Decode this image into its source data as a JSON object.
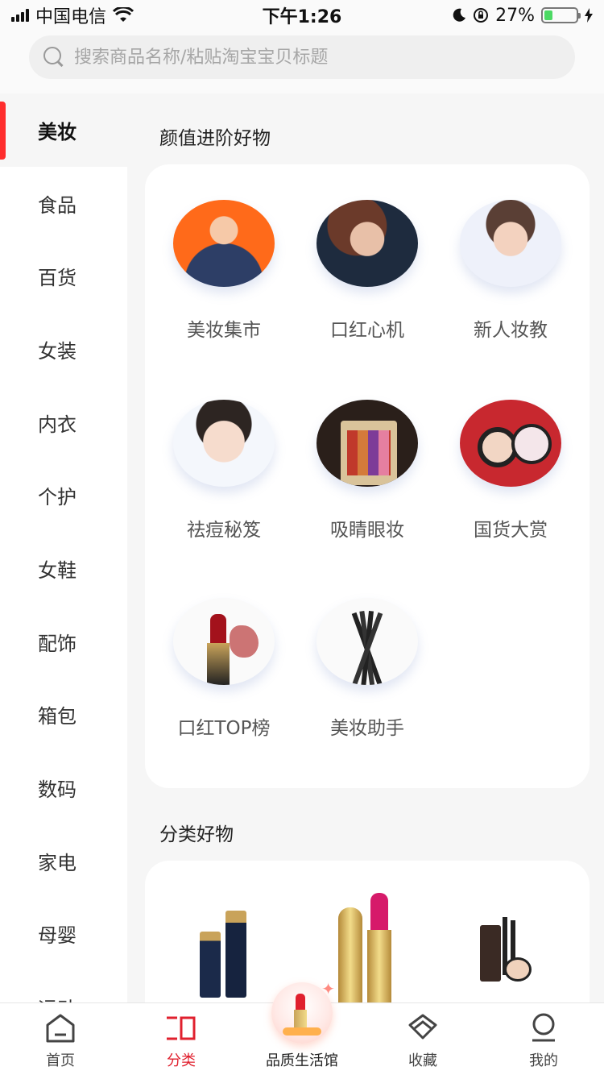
{
  "status_bar": {
    "carrier": "中国电信",
    "time": "下午1:26",
    "battery": "27%",
    "battery_level": 0.27
  },
  "search": {
    "placeholder": "搜索商品名称/粘贴淘宝宝贝标题"
  },
  "sidebar": {
    "items": [
      {
        "label": "美妆",
        "active": true
      },
      {
        "label": "食品"
      },
      {
        "label": "百货"
      },
      {
        "label": "女装"
      },
      {
        "label": "内衣"
      },
      {
        "label": "个护"
      },
      {
        "label": "女鞋"
      },
      {
        "label": "配饰"
      },
      {
        "label": "箱包"
      },
      {
        "label": "数码"
      },
      {
        "label": "家电"
      },
      {
        "label": "母婴"
      },
      {
        "label": "运动"
      }
    ]
  },
  "sections": {
    "featured_title": "颜值进阶好物",
    "featured": [
      {
        "label": "美妆集市",
        "icon": "makeup-market-image"
      },
      {
        "label": "口红心机",
        "icon": "lipstick-image"
      },
      {
        "label": "新人妆教",
        "icon": "beginner-tutorial-image"
      },
      {
        "label": "祛痘秘笈",
        "icon": "acne-tips-image"
      },
      {
        "label": "吸睛眼妆",
        "icon": "eyeshadow-palette-image"
      },
      {
        "label": "国货大赏",
        "icon": "domestic-cushion-image"
      },
      {
        "label": "口红TOP榜",
        "icon": "lipstick-top-image"
      },
      {
        "label": "美妆助手",
        "icon": "makeup-brushes-image"
      }
    ],
    "category_title": "分类好物"
  },
  "tabbar": {
    "tabs": [
      {
        "label": "首页",
        "icon": "home-icon"
      },
      {
        "label": "分类",
        "icon": "category-icon",
        "active": true
      },
      {
        "label": "品质生活馆",
        "icon": "quality-life-icon"
      },
      {
        "label": "收藏",
        "icon": "favorite-icon"
      },
      {
        "label": "我的",
        "icon": "profile-icon"
      }
    ]
  },
  "colors": {
    "accent": "#e0202e",
    "sidebar_indicator": "#ff2d2d"
  }
}
